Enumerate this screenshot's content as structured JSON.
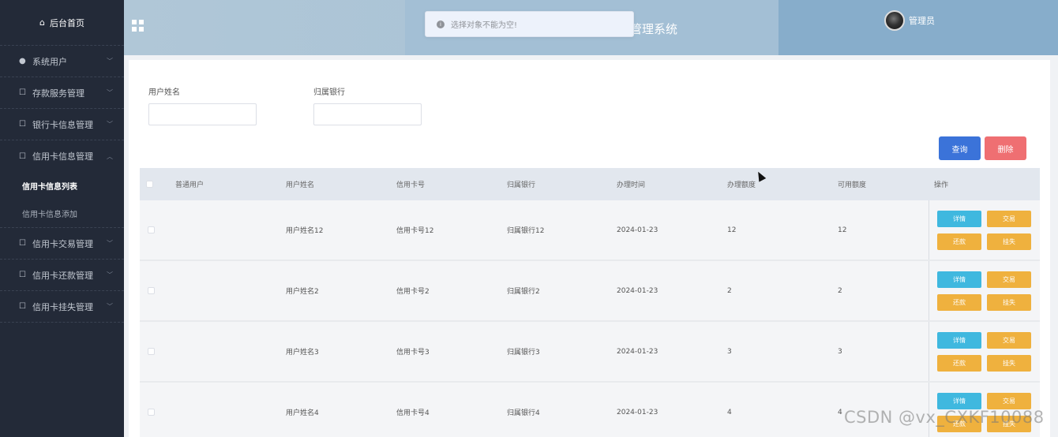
{
  "sidebar": {
    "home": {
      "label": "后台首页",
      "icon": "home-icon"
    },
    "items": [
      {
        "label": "系统用户",
        "icon": "user-icon"
      },
      {
        "label": "存款服务管理",
        "icon": "doc-icon"
      },
      {
        "label": "银行卡信息管理",
        "icon": "doc-icon"
      },
      {
        "label": "信用卡信息管理",
        "icon": "doc-icon",
        "expanded": true,
        "children": [
          {
            "label": "信用卡信息列表",
            "active": true
          },
          {
            "label": "信用卡信息添加"
          }
        ]
      },
      {
        "label": "信用卡交易管理",
        "icon": "doc-icon"
      },
      {
        "label": "信用卡还款管理",
        "icon": "doc-icon"
      },
      {
        "label": "信用卡挂失管理",
        "icon": "doc-icon"
      }
    ]
  },
  "header": {
    "title": "管理系统",
    "toast": "选择对象不能为空!",
    "user": "管理员"
  },
  "search": {
    "name_label": "用户姓名",
    "bank_label": "归属银行",
    "name_value": "",
    "bank_value": ""
  },
  "buttons": {
    "query": "查询",
    "delete": "删除"
  },
  "table": {
    "columns": [
      "普通用户",
      "用户姓名",
      "信用卡号",
      "归属银行",
      "办理时间",
      "办理额度",
      "可用额度",
      "操作"
    ],
    "rows": [
      {
        "user": "",
        "name": "用户姓名12",
        "card": "信用卡号12",
        "bank": "归属银行12",
        "date": "2024-01-23",
        "limit": "12",
        "avail": "12"
      },
      {
        "user": "",
        "name": "用户姓名2",
        "card": "信用卡号2",
        "bank": "归属银行2",
        "date": "2024-01-23",
        "limit": "2",
        "avail": "2"
      },
      {
        "user": "",
        "name": "用户姓名3",
        "card": "信用卡号3",
        "bank": "归属银行3",
        "date": "2024-01-23",
        "limit": "3",
        "avail": "3"
      },
      {
        "user": "",
        "name": "用户姓名4",
        "card": "信用卡号4",
        "bank": "归属银行4",
        "date": "2024-01-23",
        "limit": "4",
        "avail": "4"
      }
    ],
    "ops": {
      "detail": "详情",
      "trade": "交易",
      "repay": "还款",
      "lost": "挂失"
    }
  },
  "watermark": "CSDN @vx_CXKF10088",
  "colors": {
    "sidebar": "#232a38",
    "query": "#3b73d9",
    "delete": "#ef6f72",
    "detail": "#3fb8df",
    "op": "#efb13e"
  }
}
